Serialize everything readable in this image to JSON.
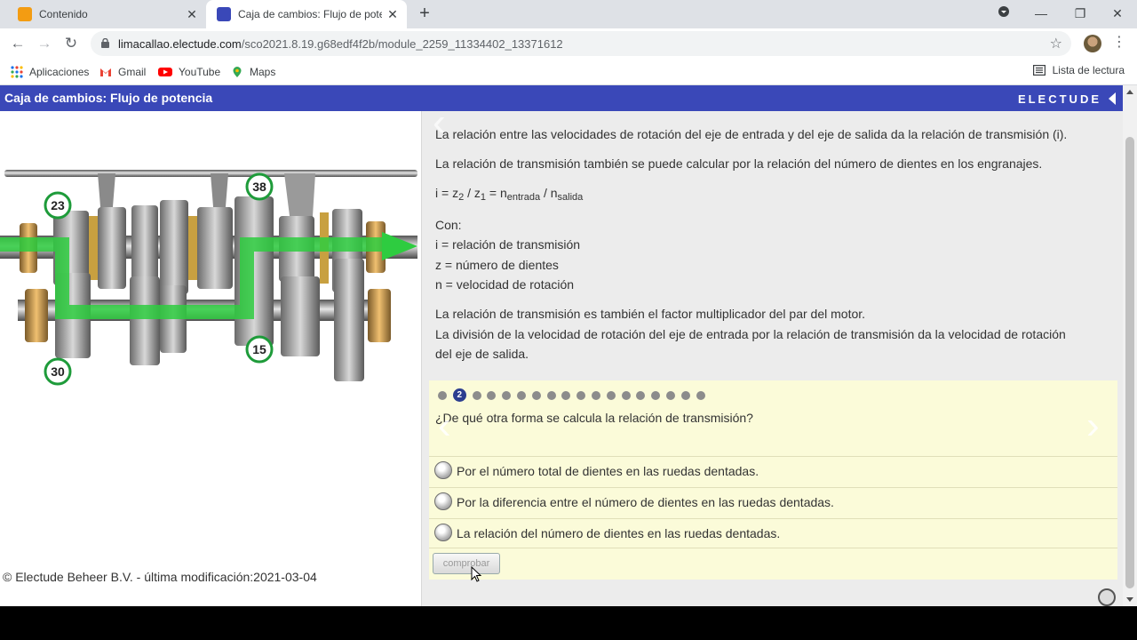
{
  "browser": {
    "tabs": [
      {
        "title": "Contenido",
        "active": false
      },
      {
        "title": "Caja de cambios: Flujo de potenc",
        "active": true
      }
    ],
    "url_host": "limacallao.electude.com",
    "url_path": "/sco2021.8.19.g68edf4f2b/module_2259_11334402_13371612",
    "bookmarks": [
      {
        "label": "Aplicaciones",
        "icon": "apps-grid-icon"
      },
      {
        "label": "Gmail",
        "icon": "gmail-icon"
      },
      {
        "label": "YouTube",
        "icon": "youtube-icon"
      },
      {
        "label": "Maps",
        "icon": "maps-icon"
      }
    ],
    "reading_list": "Lista de lectura"
  },
  "header": {
    "title": "Caja de cambios: Flujo de potencia",
    "brand": "ELECTUDE"
  },
  "diagram": {
    "gear_labels": [
      "23",
      "38",
      "15",
      "30"
    ]
  },
  "footer": "© Electude Beheer B.V. - última modificación:2021-03-04",
  "content": {
    "p1": "La relación entre las velocidades de rotación del eje de entrada y del eje de salida da la relación de transmisión (i).",
    "p2": "La relación de transmisión también se puede calcular por la relación del número de dientes en los engranajes.",
    "formula": {
      "prefix": "i = z",
      "sub1": "2",
      "mid1": " / z",
      "sub2": "1",
      "mid2": " = n",
      "sub3": "entrada",
      "mid3": " / n",
      "sub4": "salida"
    },
    "con": "Con:",
    "defs": [
      "i = relación de transmisión",
      "z = número de dientes",
      "n = velocidad de rotación"
    ],
    "p3": "La relación de transmisión es también el factor multiplicador del par del motor.",
    "p4a": "La división de la velocidad de rotación del eje de entrada por la relación de transmisión da la velocidad de rotación",
    "p4b": "del eje de salida."
  },
  "quiz": {
    "total_steps": 18,
    "current_step": "2",
    "question": "¿De qué otra forma se calcula la relación de transmisión?",
    "options": [
      "Por el número total de dientes en las ruedas dentadas.",
      "Por la diferencia entre el número de dientes en las ruedas dentadas.",
      "La relación del número de dientes en las ruedas dentadas."
    ],
    "check_button": "comprobar"
  },
  "colors": {
    "header_bg": "#3a48b8",
    "quiz_bg": "#fbfbd9",
    "flow_green": "#2ecc40"
  }
}
